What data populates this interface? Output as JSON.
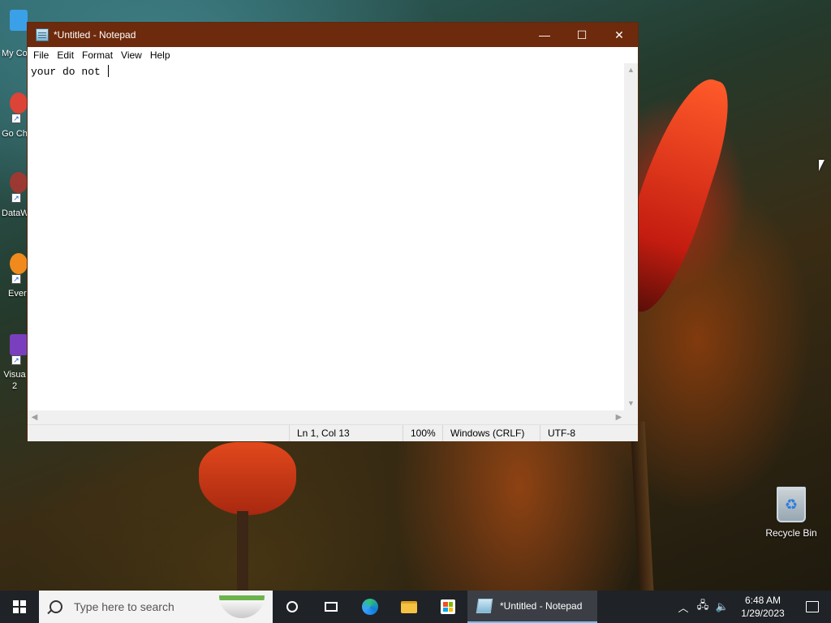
{
  "desktop": {
    "icons": [
      {
        "label": "My Co",
        "icon": "computer-icon",
        "color": "#3aa0e8"
      },
      {
        "label": "Go Ch",
        "icon": "chrome-icon",
        "color": "#db4437"
      },
      {
        "label": "DataW",
        "icon": "datawrapper-icon",
        "color": "#b8322a"
      },
      {
        "label": "Ever",
        "icon": "everything-icon",
        "color": "#f08a1c"
      },
      {
        "label": "Visua 2",
        "icon": "visual-studio-icon",
        "color": "#7a3fbf"
      }
    ],
    "recycle_bin": {
      "label": "Recycle Bin",
      "icon": "recycle-bin-icon"
    }
  },
  "notepad": {
    "title": "*Untitled - Notepad",
    "controls": {
      "minimize": "—",
      "maximize": "☐",
      "close": "✕"
    },
    "menu": [
      "File",
      "Edit",
      "Format",
      "View",
      "Help"
    ],
    "content": "your do not ",
    "status": {
      "position": "Ln 1, Col 13",
      "zoom": "100%",
      "line_ending": "Windows (CRLF)",
      "encoding": "UTF-8"
    }
  },
  "taskbar": {
    "search_placeholder": "Type here to search",
    "active_app_label": "*Untitled - Notepad",
    "time": "6:48 AM",
    "date": "1/29/2023"
  },
  "colors": {
    "titlebar": "#6d2a0c",
    "taskbar": "#1f2227",
    "accent": "#76b9ed"
  }
}
